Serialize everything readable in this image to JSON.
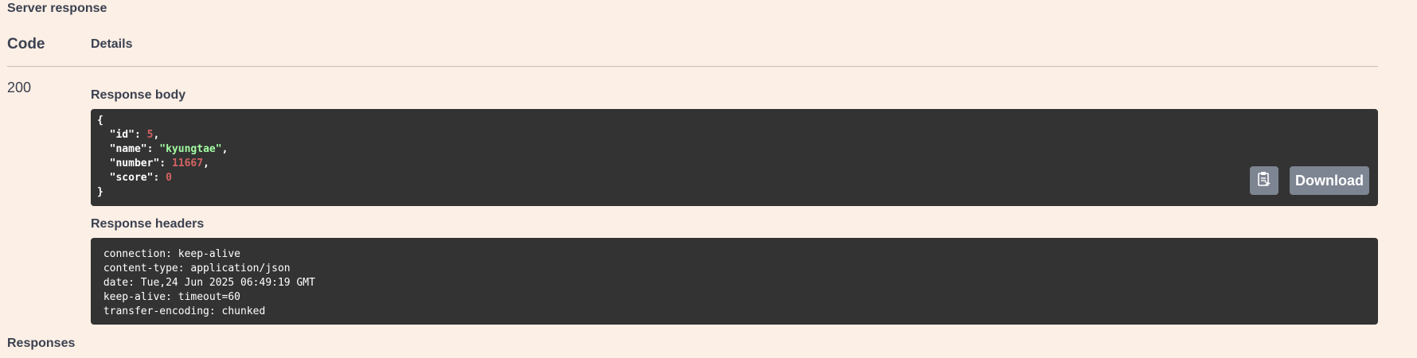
{
  "server_response": {
    "title": "Server response",
    "columns": {
      "code": "Code",
      "details": "Details"
    },
    "status_code": "200",
    "body_label": "Response body",
    "body_lines": [
      {
        "indent": "",
        "parts": [
          {
            "t": "{",
            "c": "punct"
          }
        ]
      },
      {
        "indent": "  ",
        "parts": [
          {
            "t": "\"id\"",
            "c": "key"
          },
          {
            "t": ": ",
            "c": "punct"
          },
          {
            "t": "5",
            "c": "num"
          },
          {
            "t": ",",
            "c": "punct"
          }
        ]
      },
      {
        "indent": "  ",
        "parts": [
          {
            "t": "\"name\"",
            "c": "key"
          },
          {
            "t": ": ",
            "c": "punct"
          },
          {
            "t": "\"kyungtae\"",
            "c": "str"
          },
          {
            "t": ",",
            "c": "punct"
          }
        ]
      },
      {
        "indent": "  ",
        "parts": [
          {
            "t": "\"number\"",
            "c": "key"
          },
          {
            "t": ": ",
            "c": "punct"
          },
          {
            "t": "11667",
            "c": "num"
          },
          {
            "t": ",",
            "c": "punct"
          }
        ]
      },
      {
        "indent": "  ",
        "parts": [
          {
            "t": "\"score\"",
            "c": "key"
          },
          {
            "t": ": ",
            "c": "punct"
          },
          {
            "t": "0",
            "c": "num"
          }
        ]
      },
      {
        "indent": "",
        "parts": [
          {
            "t": "}",
            "c": "punct"
          }
        ]
      }
    ],
    "copy_icon": "clipboard-icon",
    "download_label": "Download",
    "headers_label": "Response headers",
    "headers_lines": [
      " connection: keep-alive ",
      " content-type: application/json ",
      " date: Tue,24 Jun 2025 06:49:19 GMT ",
      " keep-alive: timeout=60 ",
      " transfer-encoding: chunked "
    ]
  },
  "responses_title": "Responses",
  "colors": {
    "background": "#fcefe5",
    "code_block": "#333333",
    "button": "#7d8492",
    "json_string": "#a2fca2",
    "json_number": "#d36363"
  }
}
